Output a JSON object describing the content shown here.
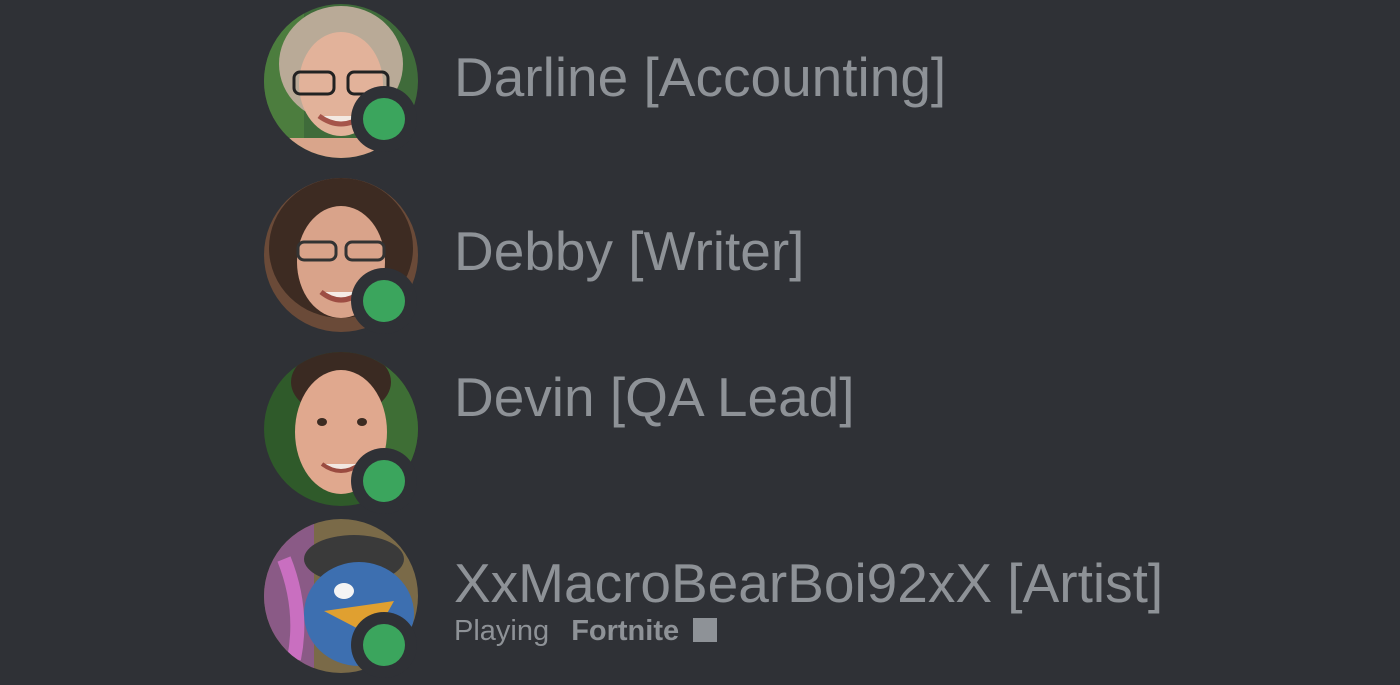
{
  "members": [
    {
      "name": "Darline [Accounting]",
      "status": "online",
      "status_color": "#3ba55d"
    },
    {
      "name": "Debby [Writer]",
      "status": "online",
      "status_color": "#3ba55d"
    },
    {
      "name": "Devin [QA Lead]",
      "status": "online",
      "status_color": "#3ba55d"
    },
    {
      "name": "XxMacroBearBoi92xX [Artist]",
      "status": "online",
      "status_color": "#3ba55d",
      "activity": {
        "prefix": "Playing",
        "game": "Fortnite",
        "icon": "rich-presence-icon"
      }
    }
  ],
  "colors": {
    "background": "#2f3136",
    "text_muted": "#8e9297",
    "online": "#3ba55d"
  }
}
